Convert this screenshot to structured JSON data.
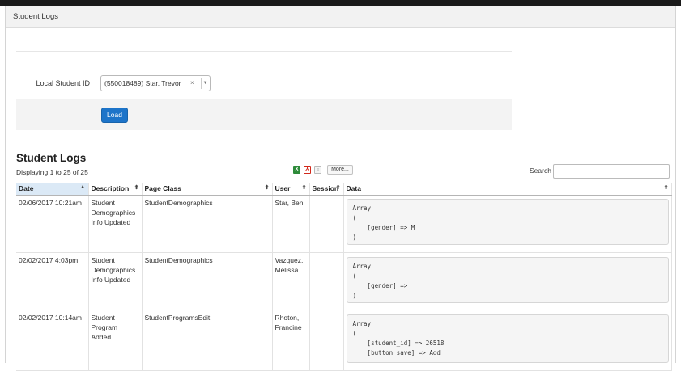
{
  "panel": {
    "title": "Student Logs"
  },
  "form": {
    "student_id_label": "Local Student ID",
    "student_select_value": "(550018489) Star, Trevor",
    "clear_glyph": "×",
    "dropdown_glyph": "▼",
    "load_button": "Load"
  },
  "logs": {
    "title": "Student Logs",
    "displaying": "Displaying 1 to 25 of 25",
    "more_button": "More...",
    "search_label": "Search",
    "search_value": ""
  },
  "export_icons": [
    "excel-icon",
    "pdf-icon",
    "document-icon"
  ],
  "table": {
    "columns": [
      {
        "label": "Date",
        "sort": "▲"
      },
      {
        "label": "Description",
        "sort": "⬍"
      },
      {
        "label": "Page Class",
        "sort": "⬍"
      },
      {
        "label": "User",
        "sort": "⬍"
      },
      {
        "label": "Session",
        "sort": "⬍"
      },
      {
        "label": "Data",
        "sort": "⬍"
      }
    ],
    "rows": [
      {
        "date": "02/06/2017 10:21am",
        "description": "Student Demographics Info Updated",
        "page_class": "StudentDemographics",
        "user": "Star, Ben",
        "session": "",
        "data": "Array\n(\n    [gender] => M\n)"
      },
      {
        "date": "02/02/2017 4:03pm",
        "description": "Student Demographics Info Updated",
        "page_class": "StudentDemographics",
        "user": "Vazquez, Melissa",
        "session": "",
        "data": "Array\n(\n    [gender] =>\n)"
      },
      {
        "date": "02/02/2017 10:14am",
        "description": "Student Program Added",
        "page_class": "StudentProgramsEdit",
        "user": "Rhoton, Francine",
        "session": "",
        "data": "Array\n(\n    [student_id] => 26518\n    [button_save] => Add"
      }
    ]
  },
  "colors": {
    "primary_button": "#1d74c9",
    "active_sort_header": "#dbe9f6",
    "panel_header_bg": "#f2f2f2"
  }
}
